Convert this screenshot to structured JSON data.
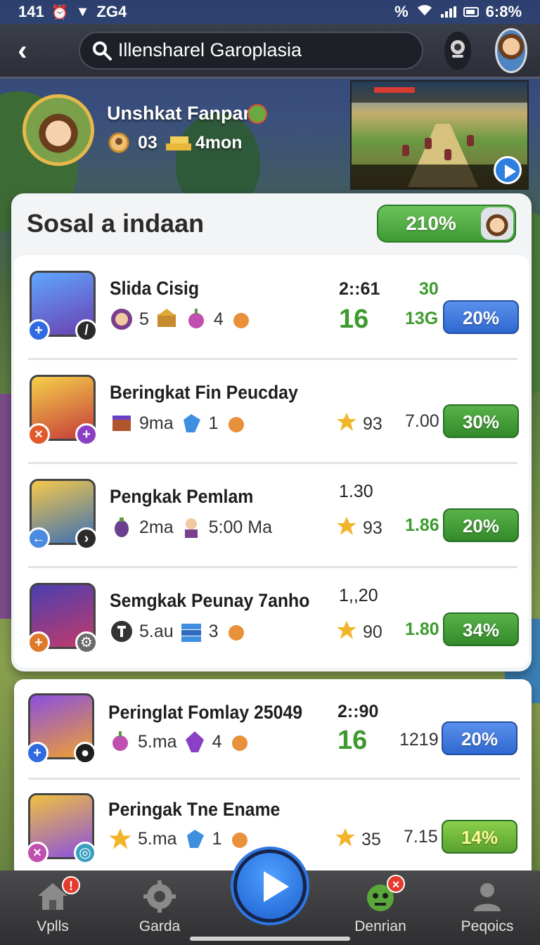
{
  "status_bar": {
    "time": "141",
    "network": "ZG4",
    "battery": "6:8%",
    "percent_sign": "%"
  },
  "app_bar": {
    "search_text": "Illensharel Garoplasia"
  },
  "profile": {
    "name": "Unshkat Fanpan",
    "stat_a": "03",
    "stat_b": "4mon"
  },
  "panel": {
    "title": "Sosal a indaan",
    "percent": "210%"
  },
  "rows": [
    {
      "title": "Slida Cisig",
      "meta1": "5",
      "meta2": "4",
      "col_top": "2::61",
      "col_big": "16",
      "col_green_top": "30",
      "col_right": "13G",
      "pct": "20%"
    },
    {
      "title": "Beringkat Fin Peucday",
      "meta1": "9ma",
      "meta2": "1",
      "col_mid": "93",
      "col_right": "7.00",
      "pct": "30%"
    },
    {
      "title": "Pengkak Pemlam",
      "meta1": "2ma",
      "meta2": "5:00 Ma",
      "col_top": "1.30",
      "col_mid": "93",
      "col_right": "1.86",
      "pct": "20%"
    },
    {
      "title": "Semgkak Peunay 7anho",
      "meta1": "5.au",
      "meta2": "3",
      "col_top": "1,,20",
      "col_mid": "90",
      "col_right": "1.80",
      "pct": "34%"
    },
    {
      "title": "Peringlat Fomlay 25049",
      "meta1": "5.ma",
      "meta2": "4",
      "col_top": "2::90",
      "col_big": "16",
      "col_right": "1219",
      "pct": "20%"
    },
    {
      "title": "Peringak Tne Ename",
      "meta1": "5.ma",
      "meta2": "1",
      "col_mid": "35",
      "col_right": "7.15",
      "pct": "14%"
    }
  ],
  "bottom_nav": {
    "items": [
      "Vplls",
      "Garda",
      "Denrian",
      "Peqoics"
    ],
    "notif": "!",
    "notif_x": "×"
  },
  "colors": {
    "accent_green": "#3d9a2e",
    "accent_blue": "#2f68d0",
    "panel_bg": "#f3f4f6"
  },
  "icons": [
    "back-icon",
    "search-icon",
    "camera-icon",
    "home-icon",
    "gear-icon",
    "play-icon",
    "monster-icon",
    "person-icon",
    "star-icon",
    "coin-icon"
  ]
}
